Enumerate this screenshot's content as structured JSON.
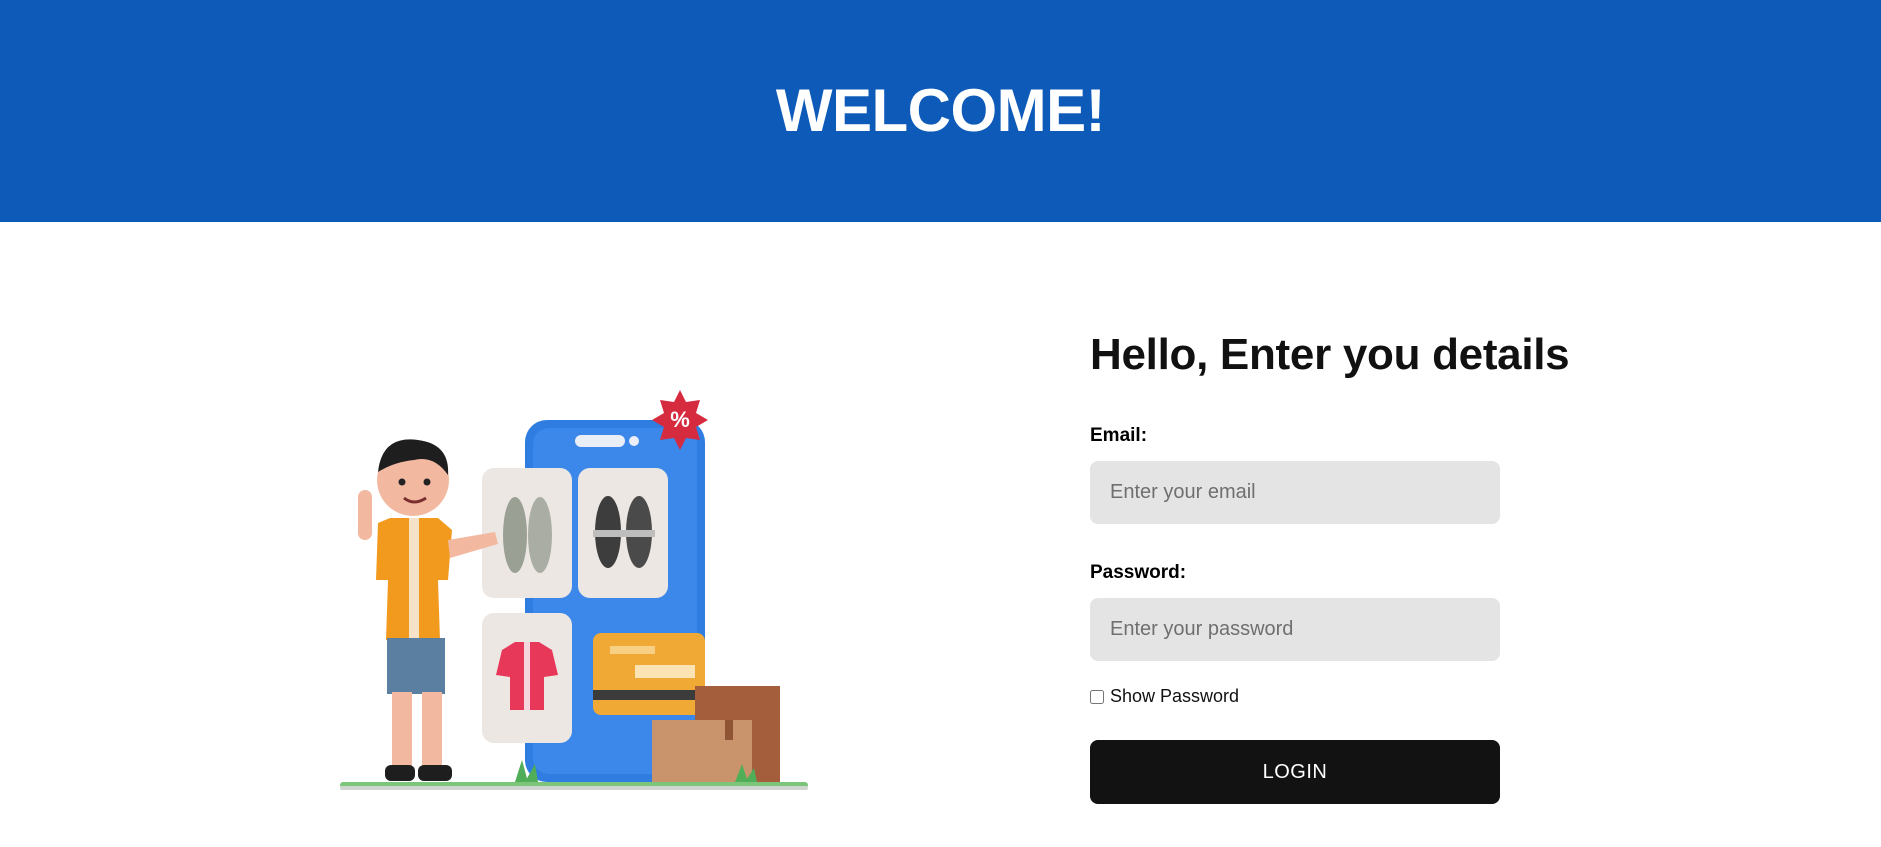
{
  "header": {
    "title": "WELCOME!"
  },
  "form": {
    "heading": "Hello, Enter you details",
    "email_label": "Email:",
    "email_placeholder": "Enter your email",
    "email_value": "",
    "password_label": "Password:",
    "password_placeholder": "Enter your password",
    "password_value": "",
    "show_password_label": "Show Password",
    "show_password_checked": false,
    "login_label": "LOGIN"
  },
  "illustration": {
    "description_icon": "shopping-illustration",
    "badge_text": "%"
  },
  "colors": {
    "header_bg": "#0d5ab8",
    "button_bg": "#121212",
    "input_bg": "#e4e4e4"
  }
}
